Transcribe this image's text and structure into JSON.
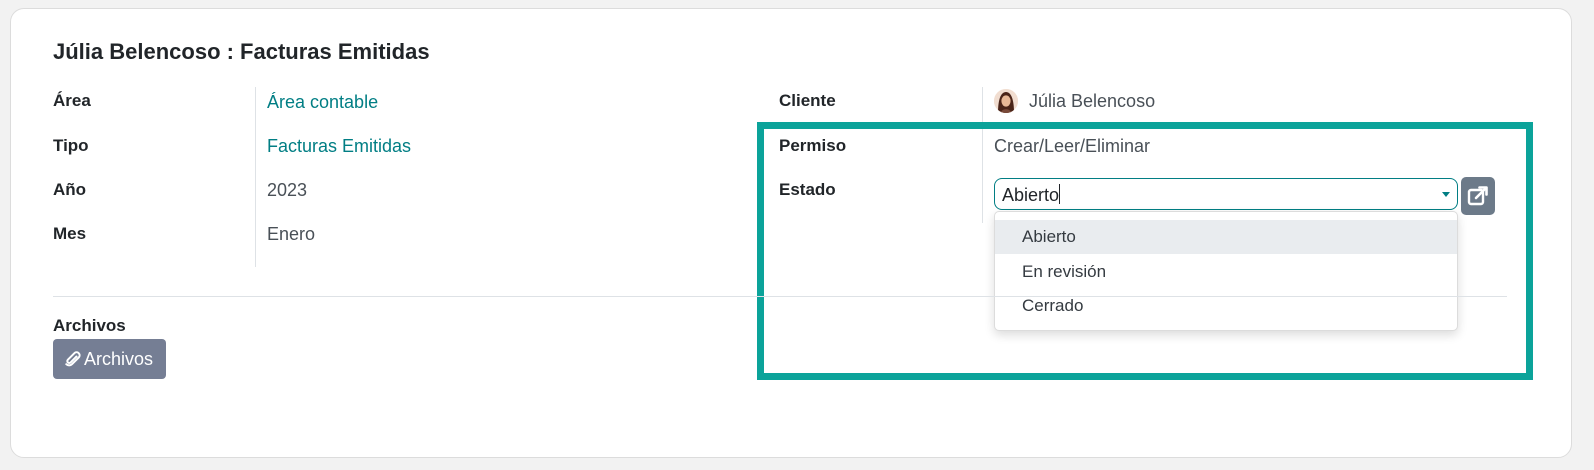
{
  "record": {
    "title": "Júlia Belencoso : Facturas Emitidas"
  },
  "fields": {
    "area": {
      "label": "Área",
      "value": "Área contable"
    },
    "tipo": {
      "label": "Tipo",
      "value": "Facturas Emitidas"
    },
    "anio": {
      "label": "Año",
      "value": "2023"
    },
    "mes": {
      "label": "Mes",
      "value": "Enero"
    },
    "cliente": {
      "label": "Cliente",
      "value": "Júlia Belencoso"
    },
    "permiso": {
      "label": "Permiso",
      "value": "Crear/Leer/Eliminar"
    },
    "estado": {
      "label": "Estado",
      "value": "Abierto",
      "options": [
        "Abierto",
        "En revisión",
        "Cerrado"
      ],
      "highlighted_option": "Abierto"
    }
  },
  "attachments": {
    "label": "Archivos",
    "button_label": "Archivos",
    "button_icon": "paperclip-icon"
  },
  "icons": {
    "external_link": "external-link-icon",
    "dropdown": "chevron-down-icon",
    "avatar": "avatar"
  },
  "colors": {
    "accent": "#017e84",
    "highlight_border": "#0ba39a",
    "attach_button": "#757e94",
    "external_button": "#6c7a89"
  }
}
